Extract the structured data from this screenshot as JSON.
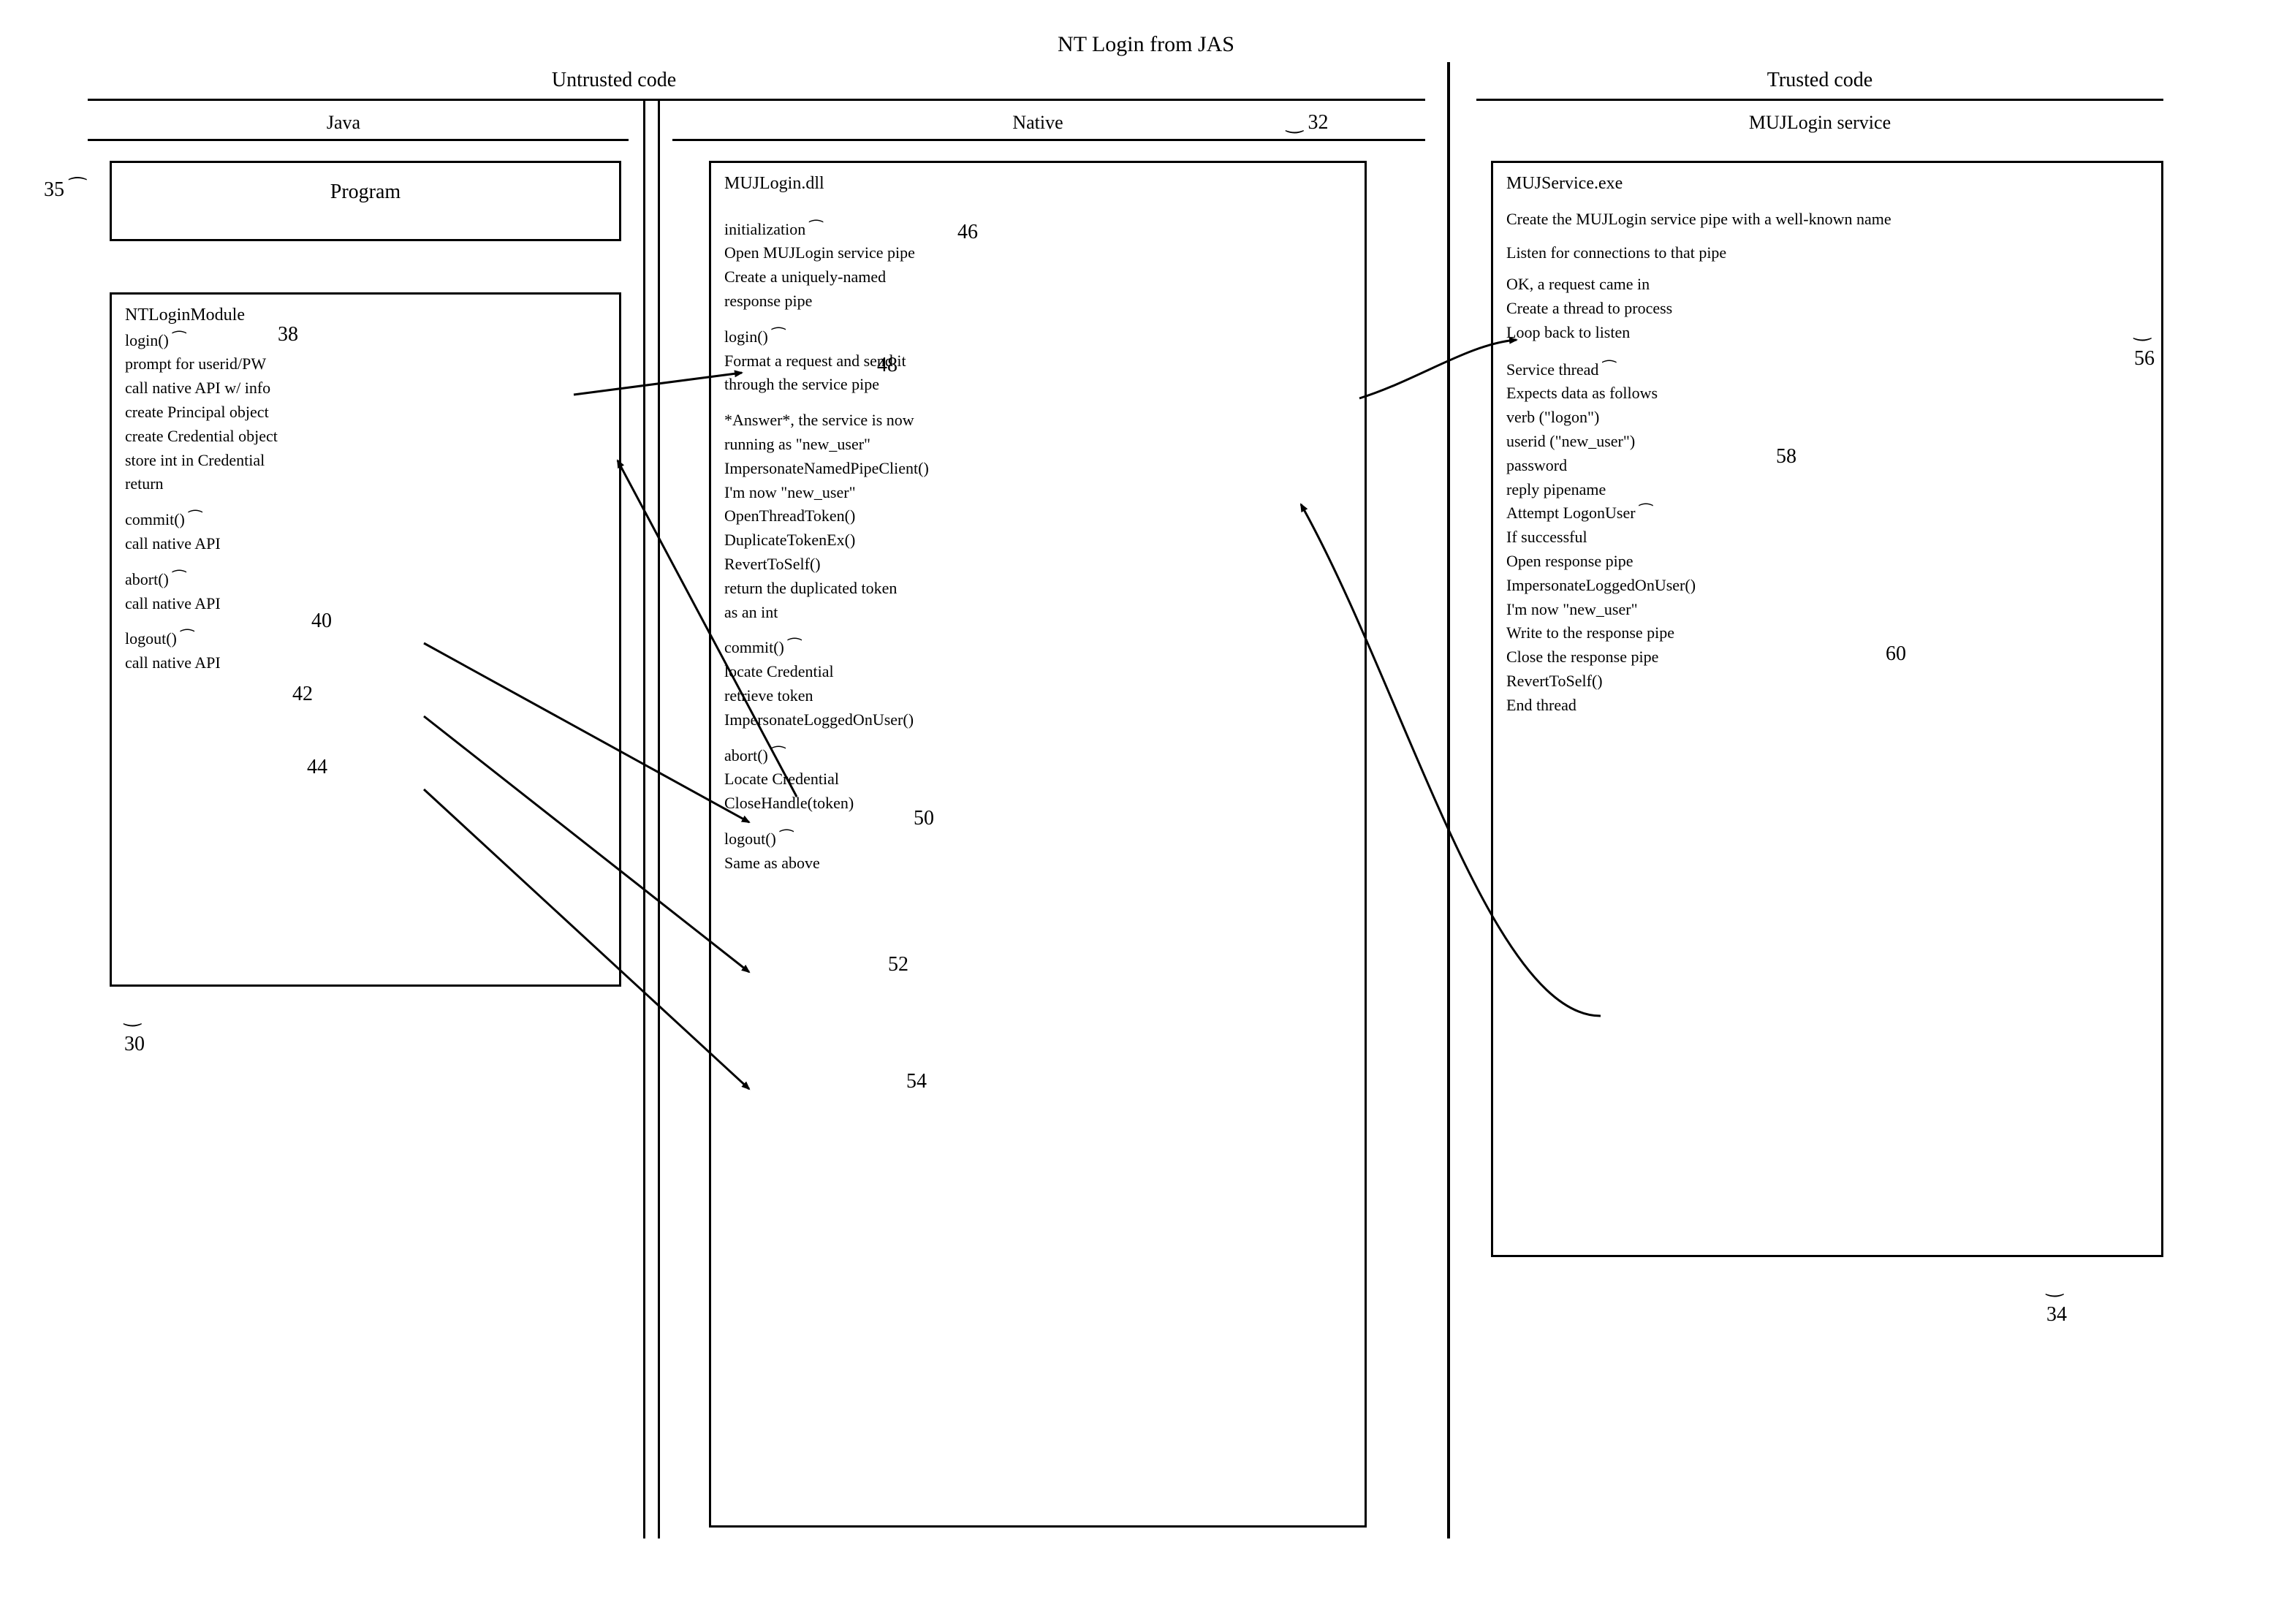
{
  "title": "NT Login from JAS",
  "sections": {
    "untrusted": "Untrusted code",
    "trusted": "Trusted code"
  },
  "columns": {
    "java": "Java",
    "native": "Native",
    "muj": "MUJLogin service"
  },
  "programBox": "Program",
  "refs": {
    "r30": "30",
    "r32": "32",
    "r34": "34",
    "r35": "35",
    "r38": "38",
    "r40": "40",
    "r42": "42",
    "r44": "44",
    "r46": "46",
    "r48": "48",
    "r50": "50",
    "r52": "52",
    "r54": "54",
    "r56": "56",
    "r58": "58",
    "r60": "60"
  },
  "javaBox": {
    "title": "NTLoginModule",
    "login": "login()",
    "login_body": [
      "prompt for userid/PW",
      "call native API w/ info",
      "",
      "create Principal object",
      "create Credential object",
      "store int in Credential",
      "return"
    ],
    "commit": "commit()",
    "commit_body": [
      "call native API"
    ],
    "abort": "abort()",
    "abort_body": [
      "call native API"
    ],
    "logout": "logout()",
    "logout_body": [
      "call native API"
    ]
  },
  "nativeBox": {
    "title": "MUJLogin.dll",
    "init": "initialization",
    "init_body": [
      "Open MUJLogin service pipe",
      "Create a uniquely-named"
    ],
    "init_body_end": "response pipe",
    "login": "login()",
    "login_body1": [
      "Format a request and send it",
      "through the service pipe"
    ],
    "login_body2": [
      "*Answer*, the service is now",
      "running as \"new_user\"",
      "ImpersonateNamedPipeClient()",
      "I'm now \"new_user\"",
      "OpenThreadToken()",
      "DuplicateTokenEx()",
      "RevertToSelf()",
      "return the duplicated token",
      "as an int"
    ],
    "commit": "commit()",
    "commit_body": [
      "locate Credential",
      "retrieve token",
      "ImpersonateLoggedOnUser()"
    ],
    "abort": "abort()",
    "abort_body": [
      "Locate Credential",
      "CloseHandle(token)"
    ],
    "logout": "logout()",
    "logout_body": [
      "Same as above"
    ]
  },
  "serviceBox": {
    "title": "MUJService.exe",
    "top": [
      "Create the MUJLogin service pipe with a well-known name",
      "Listen for connections to that pipe",
      "OK, a request came in",
      "Create a thread to process",
      "Loop back to listen"
    ],
    "thread": "Service thread",
    "thread_expects": "Expects data as follows",
    "thread_data": [
      "verb (\"logon\")",
      "userid (\"new_user\")",
      "password",
      "reply pipename"
    ],
    "attempt": "Attempt LogonUser",
    "if_succ": "If successful",
    "if_body": [
      "Open response pipe",
      "ImpersonateLoggedOnUser()",
      "I'm now \"new_user\"",
      "Write to the response pipe",
      "Close the response pipe",
      "RevertToSelf()"
    ],
    "end": "End thread"
  }
}
